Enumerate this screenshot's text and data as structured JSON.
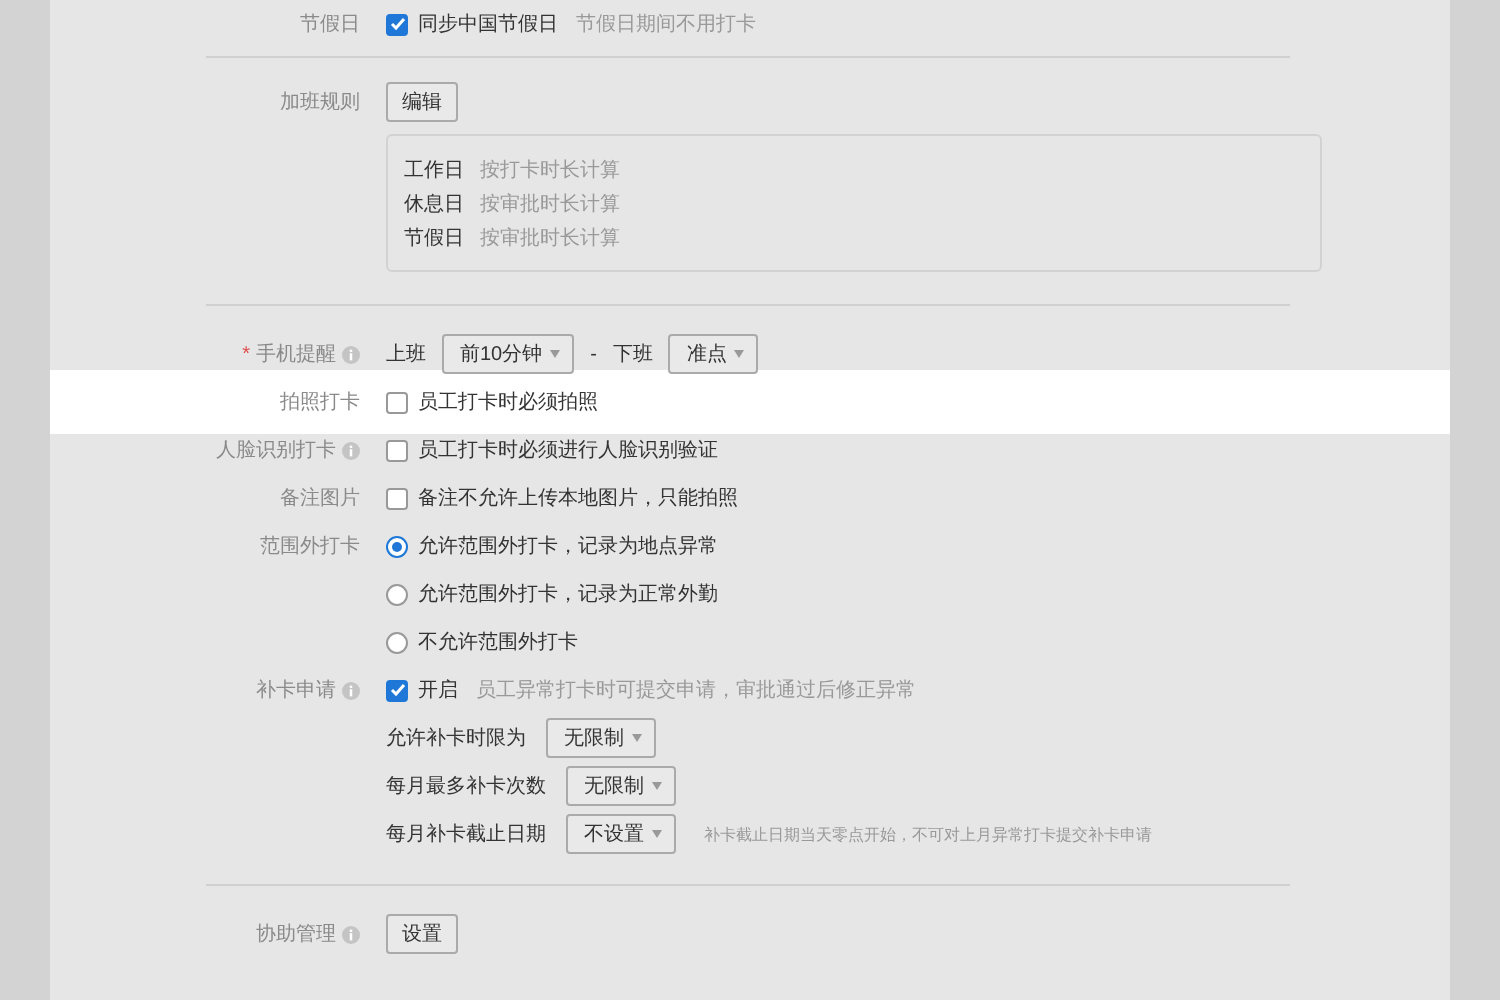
{
  "sections": [
    {
      "rows": [
        {
          "kind": "check",
          "label": "节假日",
          "info": false,
          "highlighted": false,
          "checkbox": {
            "text": "同步中国节假日",
            "checked": true
          },
          "hint": "节假日期间不用打卡"
        }
      ]
    },
    {
      "rows": [
        {
          "kind": "button",
          "label": "加班规则",
          "info": false,
          "highlighted": false,
          "button": "编辑",
          "rules": [
            {
              "day": "工作日",
              "method": "按打卡时长计算"
            },
            {
              "day": "休息日",
              "method": "按审批时长计算"
            },
            {
              "day": "节假日",
              "method": "按审批时长计算"
            }
          ]
        }
      ]
    },
    {
      "rows": [
        {
          "kind": "reminder",
          "required_mark": "*",
          "label": "手机提醒",
          "info": true,
          "highlighted": false,
          "start_label": "上班",
          "start_value": "前10分钟",
          "separator": "-",
          "end_label": "下班",
          "end_value": "准点"
        },
        {
          "kind": "check",
          "label": "拍照打卡",
          "info": false,
          "highlighted": true,
          "checkbox": {
            "text": "员工打卡时必须拍照",
            "checked": false
          }
        },
        {
          "kind": "check",
          "label": "人脸识别打卡",
          "info": true,
          "highlighted": false,
          "checkbox": {
            "text": "员工打卡时必须进行人脸识别验证",
            "checked": false
          }
        },
        {
          "kind": "check",
          "label": "备注图片",
          "info": false,
          "highlighted": false,
          "checkbox": {
            "text": "备注不允许上传本地图片，只能拍照",
            "checked": false
          }
        },
        {
          "kind": "radio",
          "label": "范围外打卡",
          "info": false,
          "highlighted": false,
          "options": [
            {
              "text": "允许范围外打卡，记录为地点异常",
              "selected": true
            },
            {
              "text": "允许范围外打卡，记录为正常外勤",
              "selected": false
            },
            {
              "text": "不允许范围外打卡",
              "selected": false
            }
          ]
        },
        {
          "kind": "makeup",
          "label": "补卡申请",
          "info": true,
          "highlighted": false,
          "checkbox": {
            "text": "开启",
            "checked": true
          },
          "hint": "员工异常打卡时可提交申请，审批通过后修正异常",
          "fields": [
            {
              "label": "允许补卡时限为",
              "value": "无限制"
            },
            {
              "label": "每月最多补卡次数",
              "value": "无限制"
            },
            {
              "label": "每月补卡截止日期",
              "value": "不设置",
              "hint": "补卡截止日期当天零点开始，不可对上月异常打卡提交补卡申请"
            }
          ]
        }
      ]
    },
    {
      "rows": [
        {
          "kind": "button",
          "label": "协助管理",
          "info": true,
          "highlighted": false,
          "button": "设置"
        }
      ]
    }
  ]
}
